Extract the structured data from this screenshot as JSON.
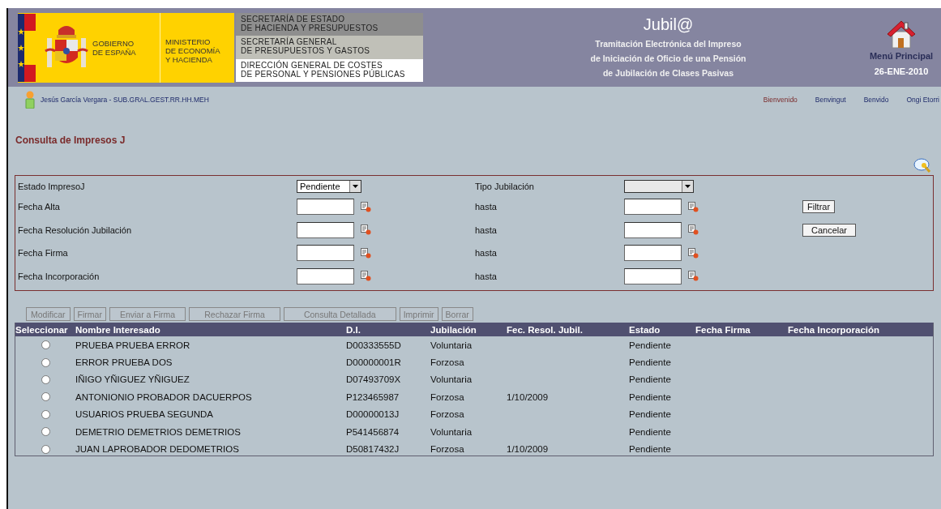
{
  "header": {
    "logo": {
      "government": "GOBIERNO\nDE ESPAÑA",
      "ministry": "MINISTERIO\nDE ECONOMÍA\nY HACIENDA",
      "units": [
        "SECRETARÍA DE ESTADO\nDE HACIENDA Y PRESUPUESTOS",
        "SECRETARÍA GENERAL\nDE PRESUPUESTOS Y GASTOS",
        "DIRECCIÓN GENERAL DE COSTES\nDE PERSONAL Y PENSIONES PÚBLICAS"
      ]
    },
    "app_title": "Jubil@",
    "subtitle": [
      "Tramitación Electrónica del Impreso",
      "de Iniciación de Oficio de una Pensión",
      "de Jubilación de Clases Pasivas"
    ],
    "home_link": "Menú Principal",
    "date": "26-ENE-2010"
  },
  "user": "Jesús García Vergara - SUB.GRAL.GEST.RR.HH.MEH",
  "languages": [
    {
      "label": "Bienvenido",
      "selected": true
    },
    {
      "label": "Benvingut",
      "selected": false
    },
    {
      "label": "Benvido",
      "selected": false
    },
    {
      "label": "Ongi Etorri",
      "selected": false
    }
  ],
  "page_title": "Consulta de Impresos J",
  "filters": [
    {
      "kind": "select",
      "label": "Estado ImpresoJ",
      "value": "Pendiente",
      "label_2": "Tipo Jubilación"
    },
    {
      "kind": "date_range",
      "label": "Fecha Alta",
      "label_2": "hasta",
      "button": "Filtrar"
    },
    {
      "kind": "date_range",
      "label": "Fecha Resolución Jubilación",
      "label_2": "hasta",
      "button": "Cancelar"
    },
    {
      "kind": "date_range",
      "label": "Fecha Firma",
      "label_2": "hasta"
    },
    {
      "kind": "date_range",
      "label": "Fecha Incorporación",
      "label_2": "hasta"
    }
  ],
  "actions": [
    {
      "label": "Modificar",
      "disabled": true
    },
    {
      "label": "Firmar",
      "disabled": true
    },
    {
      "label": "Enviar a Firma",
      "disabled": true
    },
    {
      "label": "Rechazar Firma",
      "disabled": true
    },
    {
      "label": "Consulta Detallada",
      "disabled": true
    },
    {
      "label": "Imprimir",
      "disabled": true
    },
    {
      "label": "Borrar",
      "disabled": true
    }
  ],
  "table": {
    "columns": [
      "Seleccionar",
      "Nombre Interesado",
      "D.I.",
      "Jubilación",
      "Fec. Resol. Jubil.",
      "Estado",
      "Fecha Firma",
      "Fecha Incorporación"
    ],
    "rows": [
      {
        "selected": false,
        "name": "PRUEBA PRUEBA ERROR",
        "di": "D00333555D",
        "jubilacion": "Voluntaria",
        "estado": "Pendiente"
      },
      {
        "selected": false,
        "name": "ERROR PRUEBA DOS",
        "di": "D00000001R",
        "jubilacion": "Forzosa",
        "estado": "Pendiente"
      },
      {
        "selected": false,
        "name": "IÑIGO YÑIGUEZ YÑIGUEZ",
        "di": "D07493709X",
        "jubilacion": "Voluntaria",
        "estado": "Pendiente"
      },
      {
        "selected": false,
        "name": "ANTONIONIO PROBADOR DACUERPOS",
        "di": "P123465987",
        "jubilacion": "Forzosa",
        "fec_resol": "1/10/2009",
        "estado": "Pendiente"
      },
      {
        "selected": false,
        "name": "USUARIOS PRUEBA SEGUNDA",
        "di": "D00000013J",
        "jubilacion": "Forzosa",
        "estado": "Pendiente"
      },
      {
        "selected": false,
        "name": "DEMETRIO DEMETRIOS DEMETRIOS",
        "di": "P541456874",
        "jubilacion": "Voluntaria",
        "estado": "Pendiente"
      },
      {
        "selected": false,
        "name": "JUAN LAPROBADOR DEDOMETRIOS",
        "di": "D50817432J",
        "jubilacion": "Forzosa",
        "fec_resol": "1/10/2009",
        "estado": "Pendiente"
      }
    ]
  }
}
